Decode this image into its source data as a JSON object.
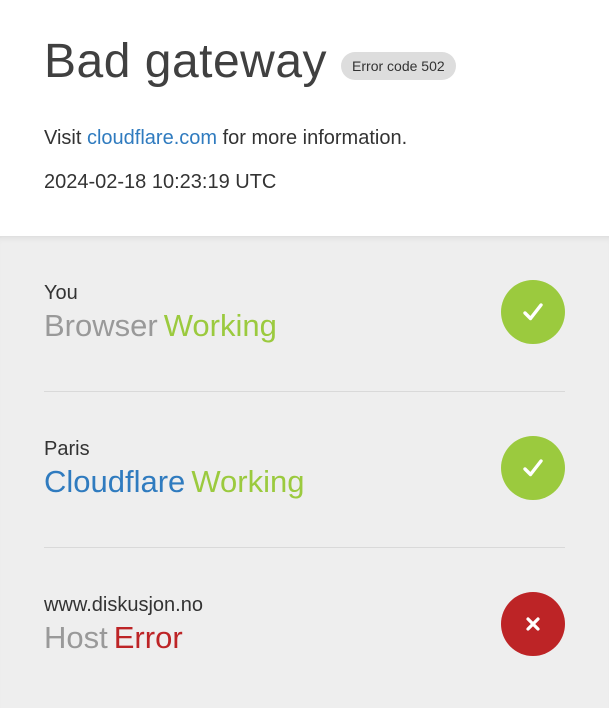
{
  "header": {
    "title": "Bad gateway",
    "error_code": "Error code 502",
    "info_prefix": "Visit",
    "info_link": "cloudflare.com",
    "info_suffix": "for more information.",
    "timestamp": "2024-02-18 10:23:19 UTC"
  },
  "colors": {
    "link": "#2f7bbf",
    "working": "#9bca3e",
    "error": "#bd2426",
    "muted": "#999999",
    "panel_bg": "#eeeeee"
  },
  "status": [
    {
      "location": "You",
      "node": "Browser",
      "state": "Working",
      "icon": "check-icon"
    },
    {
      "location": "Paris",
      "node": "Cloudflare",
      "state": "Working",
      "icon": "check-icon"
    },
    {
      "location": "www.diskusjon.no",
      "node": "Host",
      "state": "Error",
      "icon": "close-icon"
    }
  ]
}
